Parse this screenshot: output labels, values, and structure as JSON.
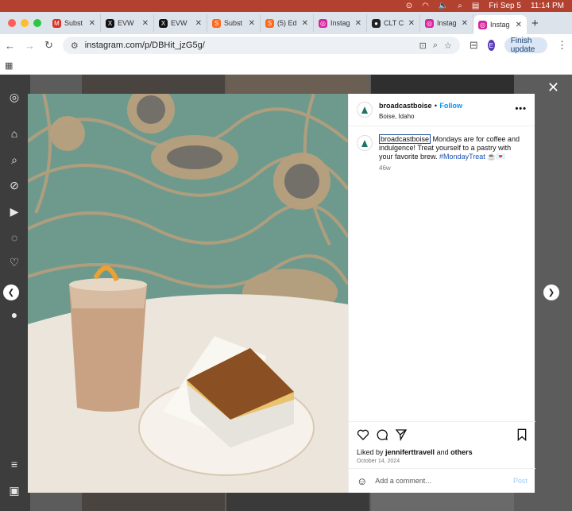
{
  "menubar": {
    "date": "Fri Sep 5",
    "time": "11:14 PM"
  },
  "tabs": [
    {
      "title": "Subst",
      "icon": "gmail-icon",
      "color": "#d93025",
      "glyph": "M"
    },
    {
      "title": "EVW",
      "icon": "x-icon",
      "color": "#111111",
      "glyph": "X"
    },
    {
      "title": "EVW",
      "icon": "x-icon",
      "color": "#111111",
      "glyph": "X"
    },
    {
      "title": "Subst",
      "icon": "substack-icon",
      "color": "#ff6719",
      "glyph": "S"
    },
    {
      "title": "(5) Ed",
      "icon": "substack-icon",
      "color": "#ff6719",
      "glyph": "S"
    },
    {
      "title": "Instag",
      "icon": "instagram-icon",
      "color": "#d6249f",
      "glyph": "◎"
    },
    {
      "title": "CLT C",
      "icon": "circle-logo-icon",
      "color": "#222222",
      "glyph": "●"
    },
    {
      "title": "Instag",
      "icon": "instagram-icon",
      "color": "#d6249f",
      "glyph": "◎"
    },
    {
      "title": "Instag",
      "icon": "instagram-icon",
      "color": "#d6249f",
      "glyph": "◎",
      "active": true
    }
  ],
  "address": {
    "url": "instagram.com/p/DBHit_jzG5g/",
    "profile_initial": "E",
    "finish_update": "Finish update"
  },
  "post": {
    "username": "broadcastboise",
    "follow": "Follow",
    "dot": "•",
    "location": "Boise, Idaho",
    "caption_text": " Mondays are for coffee and indulgence! Treat yourself to a pastry with your favorite brew. ",
    "hashtag": "#MondayTreat",
    "emoji": "☕️💌",
    "age": "46w",
    "liked_prefix": "Liked by ",
    "liked_user": "jenniferttravell",
    "liked_and": " and ",
    "liked_others": "others",
    "date": "October 14, 2024",
    "comment_placeholder": "Add a comment...",
    "post_label": "Post"
  },
  "colors": {
    "accent": "#0095f6",
    "menubar": "#b3412f",
    "overlay": "#5c5c5c"
  }
}
